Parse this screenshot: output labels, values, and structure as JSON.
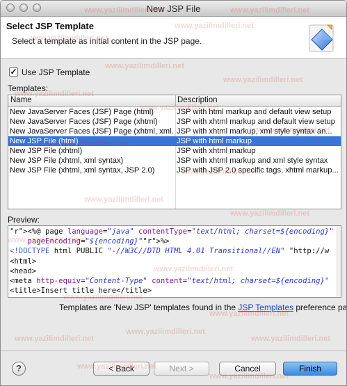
{
  "window": {
    "title": "New JSP File"
  },
  "header": {
    "title": "Select JSP Template",
    "description": "Select a template as initial content in the JSP page.",
    "icon": "jsp-wizard-icon"
  },
  "use_template": {
    "label": "Use JSP Template",
    "checked": true,
    "check_glyph": "✓"
  },
  "templates": {
    "label": "Templates:",
    "columns": [
      "Name",
      "Description"
    ],
    "rows": [
      {
        "name": "New JavaServer Faces (JSF) Page (html)",
        "description": "JSP with html markup and default view setup",
        "selected": false
      },
      {
        "name": "New JavaServer Faces (JSF) Page (xhtml)",
        "description": "JSP with xhtml markup and default view setup",
        "selected": false
      },
      {
        "name": "New JavaServer Faces (JSF) Page (xhtml, xml...",
        "description": "JSP with xhtml markup, xml style syntax an...",
        "selected": false
      },
      {
        "name": "New JSP File (html)",
        "description": "JSP with html markup",
        "selected": true
      },
      {
        "name": "New JSP File (xhtml)",
        "description": "JSP with xhtml markup",
        "selected": false
      },
      {
        "name": "New JSP File (xhtml, xml syntax)",
        "description": "JSP with xhtml markup and xml style syntax",
        "selected": false
      },
      {
        "name": "New JSP File (xhtml, xml syntax, JSP 2.0)",
        "description": "JSP with JSP 2.0 specific tags, xhtml markup...",
        "selected": false
      }
    ]
  },
  "preview": {
    "label": "Preview:",
    "lines": [
      "<%@ page language=\"java\" contentType=\"text/html; charset=${encoding}\"",
      "    pageEncoding=\"${encoding}\"%>",
      "<!DOCTYPE html PUBLIC \"-//W3C//DTD HTML 4.01 Transitional//EN\" \"http://w",
      "<html>",
      "<head>",
      "<meta http-equiv=\"Content-Type\" content=\"text/html; charset=${encoding}\"",
      "<title>Insert title here</title>"
    ]
  },
  "info": {
    "prefix": "Templates are 'New JSP' templates found in the ",
    "link": "JSP Templates",
    "suffix": " preference page."
  },
  "buttons": {
    "help": "?",
    "back": "< Back",
    "next": "Next >",
    "cancel": "Cancel",
    "finish": "Finish"
  },
  "watermark": "www.yazilimdilleri.net",
  "colors": {
    "selection": "#3875d7",
    "finish": "#3b8be0",
    "link": "#1a47c9"
  }
}
